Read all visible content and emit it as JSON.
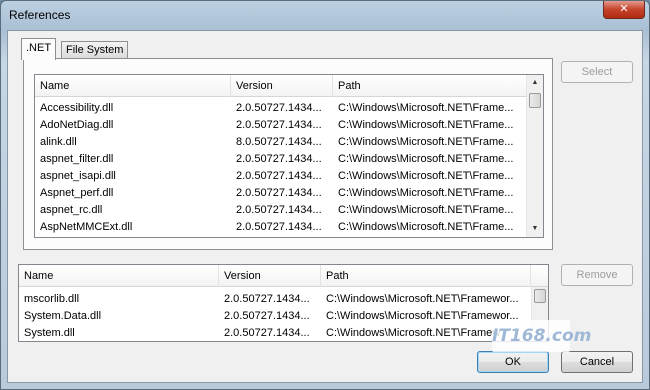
{
  "window": {
    "title": "References",
    "close_glyph": "✕"
  },
  "tabs": [
    {
      "label": ".NET",
      "active": true
    },
    {
      "label": "File System",
      "active": false
    }
  ],
  "top_list": {
    "columns": [
      "Name",
      "Version",
      "Path"
    ],
    "rows": [
      [
        "Accessibility.dll",
        "2.0.50727.1434...",
        "C:\\Windows\\Microsoft.NET\\Frame..."
      ],
      [
        "AdoNetDiag.dll",
        "2.0.50727.1434...",
        "C:\\Windows\\Microsoft.NET\\Frame..."
      ],
      [
        "alink.dll",
        "8.0.50727.1434...",
        "C:\\Windows\\Microsoft.NET\\Frame..."
      ],
      [
        "aspnet_filter.dll",
        "2.0.50727.1434...",
        "C:\\Windows\\Microsoft.NET\\Frame..."
      ],
      [
        "aspnet_isapi.dll",
        "2.0.50727.1434...",
        "C:\\Windows\\Microsoft.NET\\Frame..."
      ],
      [
        "Aspnet_perf.dll",
        "2.0.50727.1434...",
        "C:\\Windows\\Microsoft.NET\\Frame..."
      ],
      [
        "aspnet_rc.dll",
        "2.0.50727.1434...",
        "C:\\Windows\\Microsoft.NET\\Frame..."
      ],
      [
        "AspNetMMCExt.dll",
        "2.0.50727.1434...",
        "C:\\Windows\\Microsoft.NET\\Frame..."
      ]
    ]
  },
  "bottom_list": {
    "columns": [
      "Name",
      "Version",
      "Path"
    ],
    "rows": [
      [
        "mscorlib.dll",
        "2.0.50727.1434...",
        "C:\\Windows\\Microsoft.NET\\Framewor..."
      ],
      [
        "System.Data.dll",
        "2.0.50727.1434...",
        "C:\\Windows\\Microsoft.NET\\Framewor..."
      ],
      [
        "System.dll",
        "2.0.50727.1434...",
        "C:\\Windows\\Microsoft.NET\\Framew"
      ]
    ]
  },
  "buttons": {
    "select": "Select",
    "remove": "Remove",
    "ok": "OK",
    "cancel": "Cancel"
  },
  "watermark": "IT168.com"
}
